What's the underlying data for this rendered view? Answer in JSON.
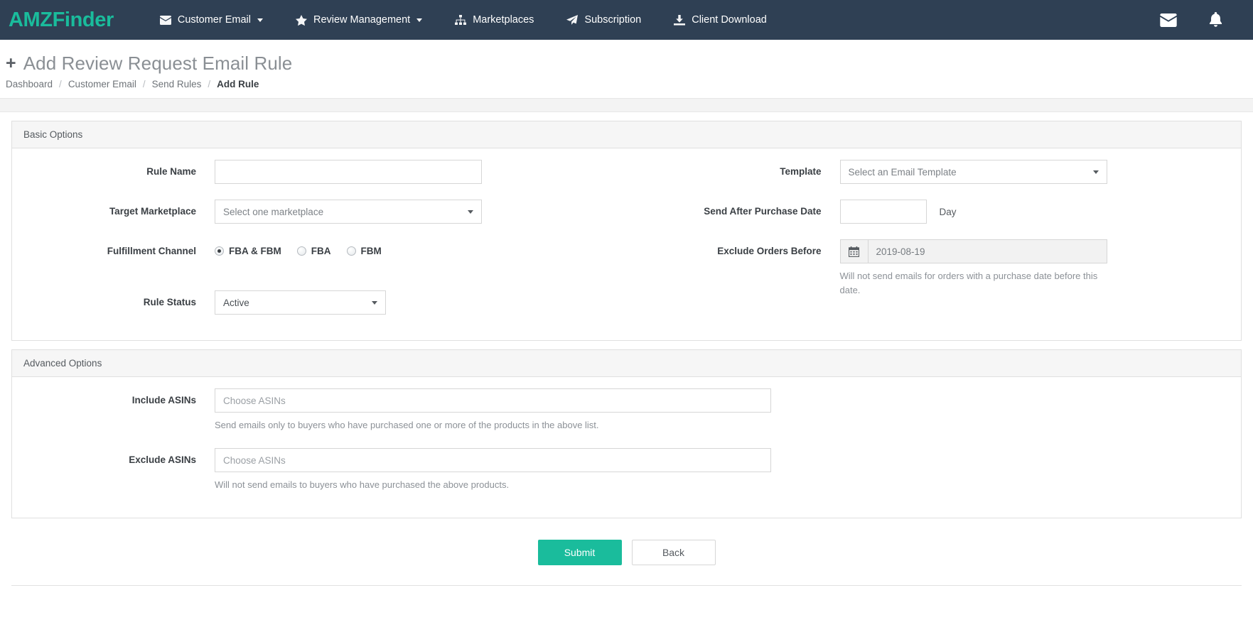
{
  "navbar": {
    "brand": "AMZFinder",
    "items": [
      {
        "label": "Customer Email",
        "icon": "envelope-icon",
        "caret": true
      },
      {
        "label": "Review Management",
        "icon": "star-icon",
        "caret": true
      },
      {
        "label": "Marketplaces",
        "icon": "sitemap-icon",
        "caret": false
      },
      {
        "label": "Subscription",
        "icon": "paper-plane-icon",
        "caret": false
      },
      {
        "label": "Client Download",
        "icon": "download-icon",
        "caret": false
      }
    ],
    "right_icons": [
      {
        "name": "mail-icon"
      },
      {
        "name": "bell-icon"
      }
    ]
  },
  "header": {
    "title": "Add Review Request Email Rule",
    "plus": "+",
    "breadcrumb": [
      {
        "label": "Dashboard",
        "current": false
      },
      {
        "label": "Customer Email",
        "current": false
      },
      {
        "label": "Send Rules",
        "current": false
      },
      {
        "label": "Add Rule",
        "current": true
      }
    ],
    "separator": "/"
  },
  "basic_options": {
    "panel_title": "Basic Options",
    "rule_name": {
      "label": "Rule Name",
      "value": "",
      "placeholder": ""
    },
    "target_marketplace": {
      "label": "Target Marketplace",
      "value": "Select one marketplace"
    },
    "fulfillment_channel": {
      "label": "Fulfillment Channel",
      "options": [
        {
          "label": "FBA & FBM",
          "selected": true
        },
        {
          "label": "FBA",
          "selected": false
        },
        {
          "label": "FBM",
          "selected": false
        }
      ]
    },
    "rule_status": {
      "label": "Rule Status",
      "value": "Active"
    },
    "template": {
      "label": "Template",
      "value": "Select an Email Template"
    },
    "send_after_purchase_date": {
      "label": "Send After Purchase Date",
      "value": "",
      "unit": "Day"
    },
    "exclude_orders_before": {
      "label": "Exclude Orders Before",
      "value": "2019-08-19",
      "icon": "calendar-icon",
      "help": "Will not send emails for orders with a purchase date before this date."
    }
  },
  "advanced_options": {
    "panel_title": "Advanced Options",
    "include_asins": {
      "label": "Include ASINs",
      "value": "",
      "placeholder": "Choose ASINs",
      "help": "Send emails only to buyers who have purchased one or more of the products in the above list."
    },
    "exclude_asins": {
      "label": "Exclude ASINs",
      "value": "",
      "placeholder": "Choose ASINs",
      "help": "Will not send emails to buyers who have purchased the above products."
    }
  },
  "footer": {
    "submit_label": "Submit",
    "back_label": "Back"
  },
  "colors": {
    "navbar_bg": "#2f4054",
    "brand_green": "#1abc9c",
    "primary_btn": "#1abc9c",
    "panel_head_bg": "#f6f6f6"
  }
}
